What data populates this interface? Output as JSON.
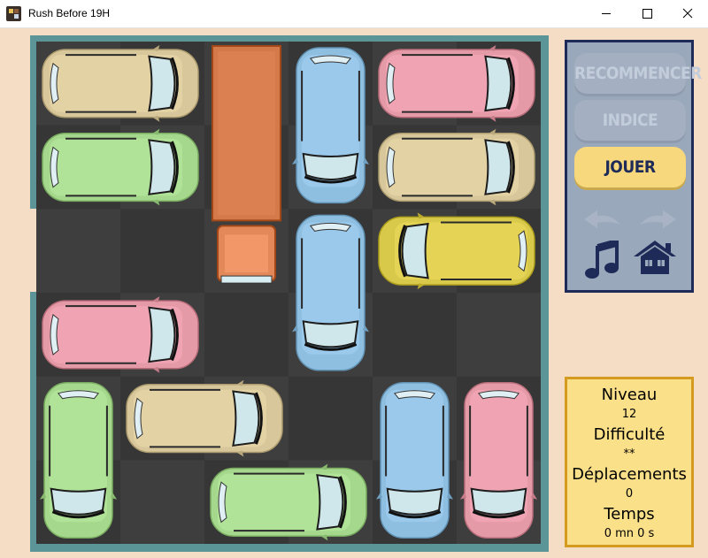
{
  "window": {
    "title": "Rush Before 19H"
  },
  "controls": {
    "restart_label": "RECOMMENCER",
    "hint_label": "INDICE",
    "play_label": "JOUER"
  },
  "stats": {
    "level_label": "Niveau",
    "level_value": "12",
    "difficulty_label": "Difficulté",
    "difficulty_value": "**",
    "moves_label": "Déplacements",
    "moves_value": "0",
    "time_label": "Temps",
    "time_value": "0 mn 0 s"
  },
  "board": {
    "cols": 6,
    "rows": 6,
    "exit_row": 2,
    "vehicles": [
      {
        "kind": "car",
        "orientation": "h",
        "col": 0,
        "row": 0,
        "len": 2,
        "color": "#d8c79a",
        "facing": "right"
      },
      {
        "kind": "car",
        "orientation": "h",
        "col": 0,
        "row": 1,
        "len": 2,
        "color": "#a5d88d",
        "facing": "right"
      },
      {
        "kind": "truck",
        "orientation": "v",
        "col": 2,
        "row": 0,
        "len": 3,
        "color": "#d4794a",
        "facing": "down"
      },
      {
        "kind": "car",
        "orientation": "v",
        "col": 3,
        "row": 0,
        "len": 2,
        "color": "#8fbfe0",
        "facing": "down"
      },
      {
        "kind": "car",
        "orientation": "h",
        "col": 4,
        "row": 0,
        "len": 2,
        "color": "#e59aa8",
        "facing": "right"
      },
      {
        "kind": "car",
        "orientation": "h",
        "col": 4,
        "row": 1,
        "len": 2,
        "color": "#d8c79a",
        "facing": "right"
      },
      {
        "kind": "car",
        "orientation": "v",
        "col": 3,
        "row": 2,
        "len": 2,
        "color": "#8fbfe0",
        "facing": "down"
      },
      {
        "kind": "car",
        "orientation": "h",
        "col": 4,
        "row": 2,
        "len": 2,
        "color": "#d9c94a",
        "facing": "left"
      },
      {
        "kind": "car",
        "orientation": "h",
        "col": 0,
        "row": 3,
        "len": 2,
        "color": "#e59aa8",
        "facing": "right"
      },
      {
        "kind": "car",
        "orientation": "v",
        "col": 0,
        "row": 4,
        "len": 2,
        "color": "#a5d88d",
        "facing": "down"
      },
      {
        "kind": "car",
        "orientation": "h",
        "col": 1,
        "row": 4,
        "len": 2,
        "color": "#d8c79a",
        "facing": "right"
      },
      {
        "kind": "car",
        "orientation": "v",
        "col": 4,
        "row": 4,
        "len": 2,
        "color": "#8fbfe0",
        "facing": "down"
      },
      {
        "kind": "car",
        "orientation": "v",
        "col": 5,
        "row": 4,
        "len": 2,
        "color": "#e59aa8",
        "facing": "down"
      },
      {
        "kind": "car",
        "orientation": "h",
        "col": 2,
        "row": 5,
        "len": 2,
        "color": "#a5d88d",
        "facing": "right"
      }
    ]
  },
  "icons": {
    "undo": "left-arrow-icon",
    "redo": "right-arrow-icon",
    "music": "music-note-icon",
    "home": "home-icon"
  },
  "colors": {
    "background": "#f4dcc5",
    "board_frame": "#5b9598",
    "panel": "#9aa8bb",
    "panel_border": "#1e2a58",
    "play_button": "#f7d87c",
    "info_box": "#fbe08a",
    "info_border": "#d59a20"
  }
}
